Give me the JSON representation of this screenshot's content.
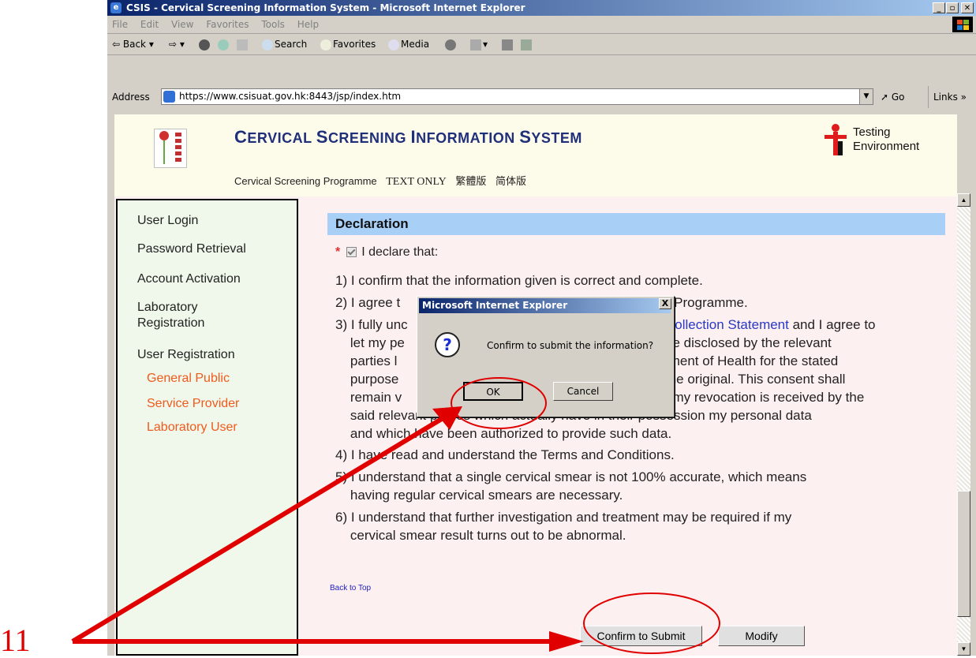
{
  "window": {
    "title": "CSIS - Cervical Screening Information System - Microsoft Internet Explorer",
    "min": "_",
    "max": "▫",
    "close": "✕"
  },
  "menu": [
    "File",
    "Edit",
    "View",
    "Favorites",
    "Tools",
    "Help"
  ],
  "toolbar": {
    "back": "Back",
    "search": "Search",
    "favorites": "Favorites",
    "media": "Media"
  },
  "address": {
    "label": "Address",
    "url": "https://www.csisuat.gov.hk:8443/jsp/index.htm",
    "go": "Go",
    "links": "Links"
  },
  "site": {
    "title_parts": [
      "C",
      "ERVICAL ",
      "S",
      "CREENING ",
      "I",
      "NFORMATION ",
      "S",
      "YSTEM"
    ],
    "nav": [
      "Cervical Screening Programme",
      "TEXT ONLY",
      "繁體版",
      "简体版"
    ],
    "badge_line1": "Testing",
    "badge_line2": "Environment"
  },
  "sidebar": {
    "items": [
      "User Login",
      "Password Retrieval",
      "Account Activation",
      "Laboratory",
      "Registration",
      "User Registration"
    ],
    "subitems": [
      "General Public",
      "Service Provider",
      "Laboratory User"
    ]
  },
  "declaration": {
    "heading": "Declaration",
    "star": "*",
    "check_label": "I declare that:",
    "lines": [
      "1) I confirm that the information given is correct and complete.",
      "2) I agree t",
      "g Programme.",
      "3) I fully unc",
      "Collection Statement",
      " and I agree to",
      "    let my pe",
      "be disclosed by the relevant",
      "    parties l",
      "tment of Health for the stated",
      "    purpose",
      "the original. This consent shall",
      "    remain v",
      "f my revocation is received by the",
      "    said relevant parties which actually have in their possession my personal data",
      "    and which have been authorized to provide such data.",
      "4) I have read and understand the Terms and Conditions.",
      "5) I understand that a single cervical smear is not 100% accurate, which means",
      "    having regular cervical smears are necessary.",
      "6) I understand that further investigation and treatment may be required if my",
      "    cervical smear result turns out to be abnormal."
    ],
    "back_to_top": "Back to Top"
  },
  "buttons": {
    "confirm": "Confirm to Submit",
    "modify": "Modify"
  },
  "dialog": {
    "title": "Microsoft Internet Explorer",
    "close": "X",
    "icon": "?",
    "message": "Confirm to submit the information?",
    "ok": "OK",
    "cancel": "Cancel"
  },
  "annotation": {
    "step": "11",
    "color": "#e00000"
  }
}
